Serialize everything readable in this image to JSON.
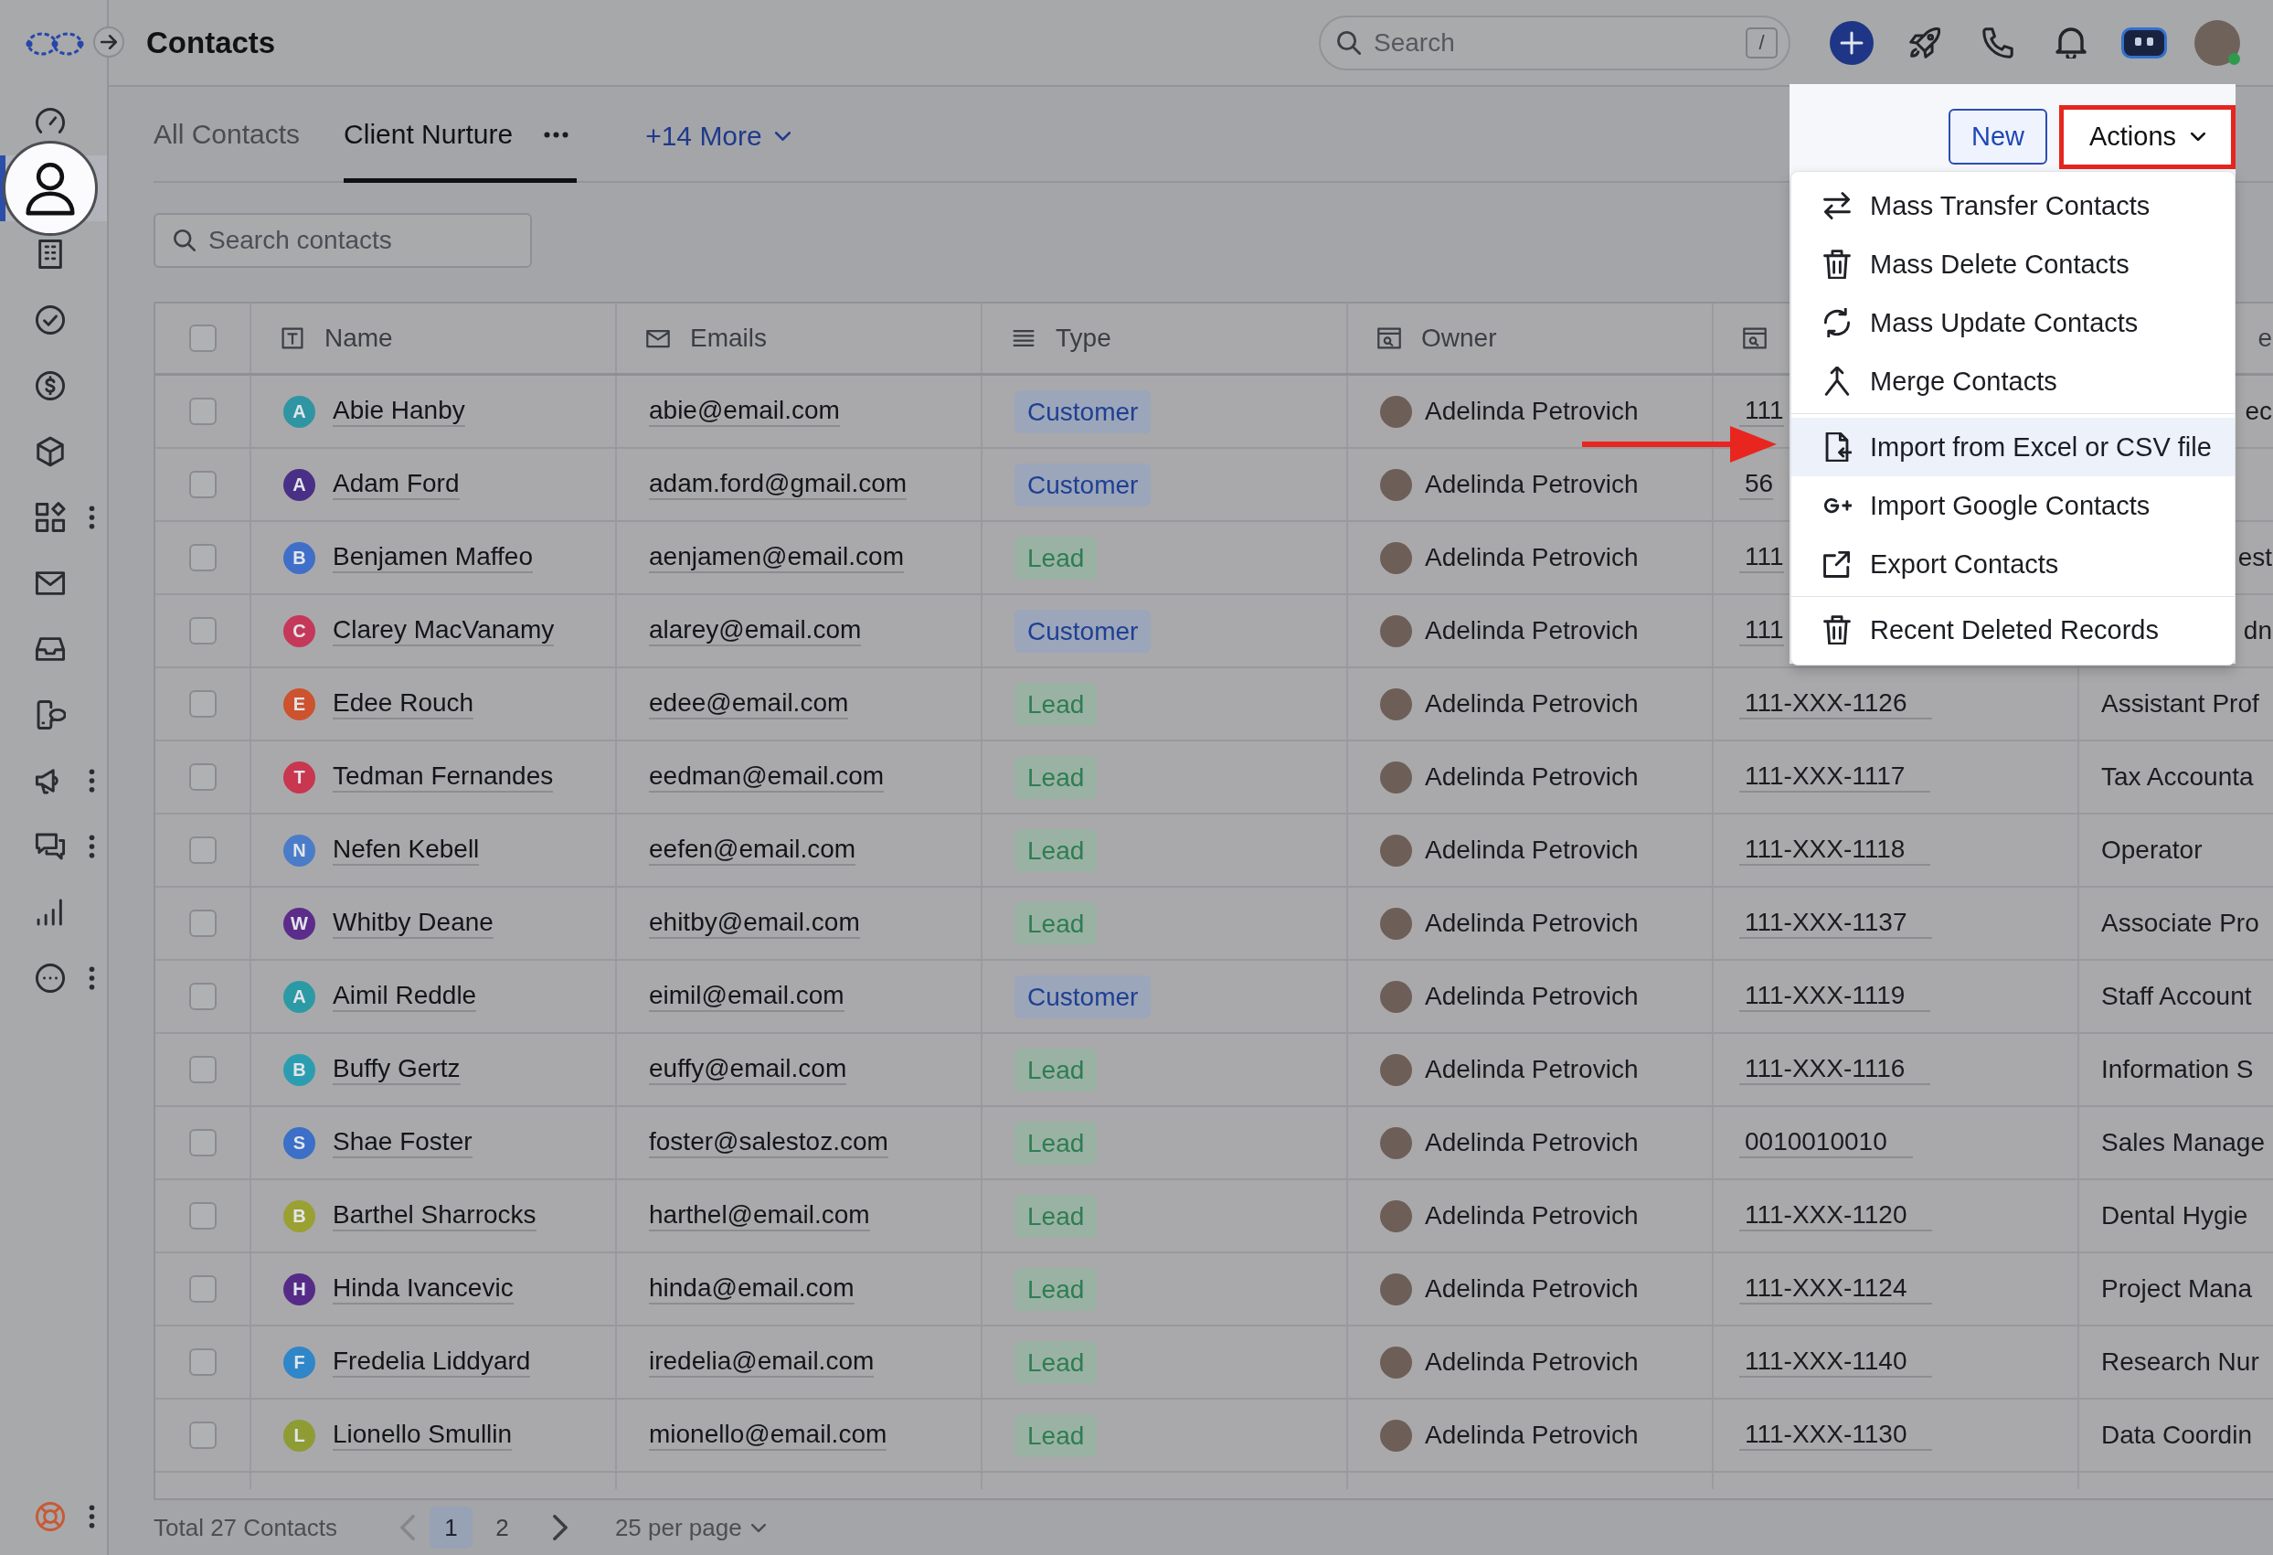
{
  "sidebar": {
    "items": [
      {
        "selected": false,
        "menu": false
      },
      {
        "selected": true,
        "menu": false
      },
      {
        "selected": false,
        "menu": false
      },
      {
        "selected": false,
        "menu": false
      },
      {
        "selected": false,
        "menu": false
      },
      {
        "selected": false,
        "menu": false
      },
      {
        "selected": false,
        "menu": true
      },
      {
        "selected": false,
        "menu": false
      },
      {
        "selected": false,
        "menu": false
      },
      {
        "selected": false,
        "menu": false
      },
      {
        "selected": false,
        "menu": true
      },
      {
        "selected": false,
        "menu": true
      },
      {
        "selected": false,
        "menu": false
      },
      {
        "selected": false,
        "menu": true
      }
    ],
    "footer_item": {
      "menu": true
    }
  },
  "top_bar": {
    "title": "Contacts",
    "search": {
      "placeholder": "Search",
      "shortcut": "/"
    },
    "user": {
      "online": true
    }
  },
  "tabs": [
    {
      "label": "All Contacts",
      "selected": false
    },
    {
      "label": "Client Nurture",
      "selected": true
    }
  ],
  "more_views": "+14 More",
  "buttons": {
    "new": "New",
    "actions": "Actions"
  },
  "actions_menu": {
    "sections": [
      {
        "items": [
          {
            "label": "Mass Transfer Contacts",
            "selected": false
          },
          {
            "label": "Mass Delete Contacts",
            "selected": false
          },
          {
            "label": "Mass Update Contacts",
            "selected": false
          },
          {
            "label": "Merge Contacts",
            "selected": false
          }
        ]
      },
      {
        "items": [
          {
            "label": "Import from Excel or CSV file",
            "selected": true
          },
          {
            "label": "Import Google Contacts",
            "selected": false
          },
          {
            "label": "Export Contacts",
            "selected": false
          }
        ]
      },
      {
        "items": [
          {
            "label": "Recent Deleted Records",
            "selected": false
          }
        ]
      }
    ]
  },
  "contact_search": {
    "placeholder": "Search contacts"
  },
  "table": {
    "select_all_checked": false,
    "headings": [
      "Name",
      "Emails",
      "Type",
      "Owner"
    ],
    "column_6_heading": "e",
    "rows": [
      {
        "checked": false,
        "initial": "A",
        "color": "#2f95a3",
        "name": "Abie Hanby",
        "email": "abie@email.com",
        "type": {
          "label": "Customer",
          "kind": "customer"
        },
        "owner": "Adelinda Petrovich",
        "column_5": "111",
        "column_6": "ec"
      },
      {
        "checked": false,
        "initial": "A",
        "color": "#4a2f86",
        "name": "Adam Ford",
        "email": "adam.ford@gmail.com",
        "type": {
          "label": "Customer",
          "kind": "customer"
        },
        "owner": "Adelinda Petrovich",
        "column_5": "56"
      },
      {
        "checked": false,
        "initial": "B",
        "color": "#3f6fc9",
        "name": "Benjamen Maffeo",
        "email": "aenjamen@email.com",
        "type": {
          "label": "Lead",
          "kind": "lead"
        },
        "owner": "Adelinda Petrovich",
        "column_5": "111",
        "column_6": "est"
      },
      {
        "checked": false,
        "initial": "C",
        "color": "#c5385a",
        "name": "Clarey MacVanamy",
        "email": "alarey@email.com",
        "type": {
          "label": "Customer",
          "kind": "customer"
        },
        "owner": "Adelinda Petrovich",
        "column_5": "111",
        "column_6": "dn"
      },
      {
        "checked": false,
        "initial": "E",
        "color": "#cc532d",
        "name": "Edee Rouch",
        "email": "edee@email.com",
        "type": {
          "label": "Lead",
          "kind": "lead"
        },
        "owner": "Adelinda Petrovich",
        "column_5": "111-XXX-1126",
        "column_6": "Assistant Prof"
      },
      {
        "checked": false,
        "initial": "T",
        "color": "#c8364f",
        "name": "Tedman Fernandes",
        "email": "eedman@email.com",
        "type": {
          "label": "Lead",
          "kind": "lead"
        },
        "owner": "Adelinda Petrovich",
        "column_5": "111-XXX-1117",
        "column_6": "Tax Accounta"
      },
      {
        "checked": false,
        "initial": "N",
        "color": "#4b7cc9",
        "name": "Nefen Kebell",
        "email": "eefen@email.com",
        "type": {
          "label": "Lead",
          "kind": "lead"
        },
        "owner": "Adelinda Petrovich",
        "column_5": "111-XXX-1118",
        "column_6": "Operator"
      },
      {
        "checked": false,
        "initial": "W",
        "color": "#5b2c8a",
        "name": "Whitby Deane",
        "email": "ehitby@email.com",
        "type": {
          "label": "Lead",
          "kind": "lead"
        },
        "owner": "Adelinda Petrovich",
        "column_5": "111-XXX-1137",
        "column_6": "Associate Pro"
      },
      {
        "checked": false,
        "initial": "A",
        "color": "#2c9aa5",
        "name": "Aimil Reddle",
        "email": "eimil@email.com",
        "type": {
          "label": "Customer",
          "kind": "customer"
        },
        "owner": "Adelinda Petrovich",
        "column_5": "111-XXX-1119",
        "column_6": "Staff Account"
      },
      {
        "checked": false,
        "initial": "B",
        "color": "#2c9db0",
        "name": "Buffy Gertz",
        "email": "euffy@email.com",
        "type": {
          "label": "Lead",
          "kind": "lead"
        },
        "owner": "Adelinda Petrovich",
        "column_5": "111-XXX-1116",
        "column_6": "Information S"
      },
      {
        "checked": false,
        "initial": "S",
        "color": "#3b6fc8",
        "name": "Shae Foster",
        "email": "foster@salestoz.com",
        "type": {
          "label": "Lead",
          "kind": "lead"
        },
        "owner": "Adelinda Petrovich",
        "column_5": "0010010010",
        "column_6": "Sales Manage"
      },
      {
        "checked": false,
        "initial": "B",
        "color": "#9aa032",
        "name": "Barthel Sharrocks",
        "email": "harthel@email.com",
        "type": {
          "label": "Lead",
          "kind": "lead"
        },
        "owner": "Adelinda Petrovich",
        "column_5": "111-XXX-1120",
        "column_6": "Dental Hygie"
      },
      {
        "checked": false,
        "initial": "H",
        "color": "#562b88",
        "name": "Hinda Ivancevic",
        "email": "hinda@email.com",
        "type": {
          "label": "Lead",
          "kind": "lead"
        },
        "owner": "Adelinda Petrovich",
        "column_5": "111-XXX-1124",
        "column_6": "Project Mana"
      },
      {
        "checked": false,
        "initial": "F",
        "color": "#2f86c8",
        "name": "Fredelia Liddyard",
        "email": "iredelia@email.com",
        "type": {
          "label": "Lead",
          "kind": "lead"
        },
        "owner": "Adelinda Petrovich",
        "column_5": "111-XXX-1140",
        "column_6": "Research Nur"
      },
      {
        "checked": false,
        "initial": "L",
        "color": "#8e9c33",
        "name": "Lionello Smullin",
        "email": "mionello@email.com",
        "type": {
          "label": "Lead",
          "kind": "lead"
        },
        "owner": "Adelinda Petrovich",
        "column_5": "111-XXX-1130",
        "column_6": "Data Coordin"
      }
    ]
  },
  "pagination": {
    "total": "Total 27 Contacts",
    "prev_disabled": true,
    "pages": [
      {
        "label": "1",
        "selected": true
      },
      {
        "label": "2",
        "selected": false
      }
    ],
    "next_disabled": false,
    "page_size": "25 per page"
  }
}
